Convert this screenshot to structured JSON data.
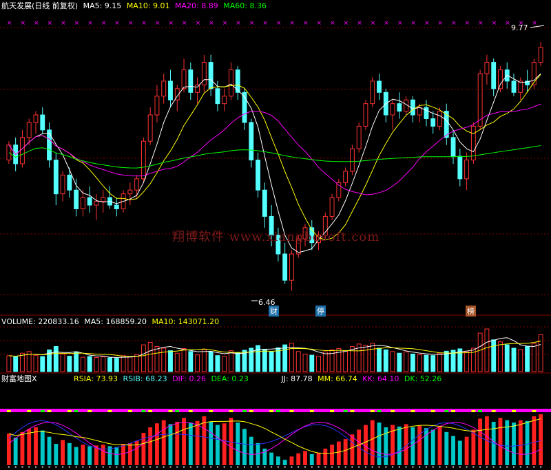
{
  "main_header": {
    "title": "航天发展(日线 前复权)",
    "ma5": "MA5: 9.15",
    "ma10": "MA10: 9.01",
    "ma20": "MA20: 8.89",
    "ma60": "MA60: 8.36"
  },
  "volume_header": {
    "title": "VOLUME: 220833.16",
    "ma5": "MA5: 168859.20",
    "ma10": "MA10: 143071.20"
  },
  "indicator_header": {
    "title": "财富地图X",
    "rsia": "RSIA: 73.93",
    "rsib": "RSIB: 68.23",
    "dif": "DIF: 0.26",
    "dea": "DEA: 0.23",
    "jj": "JJ: 87.78",
    "mm": "MM: 66.74",
    "kk": "KK: 64.10",
    "dk": "DK: 52.26"
  },
  "annotations": {
    "high_label": "9.77",
    "low_label": "6.46",
    "signal_1": "财",
    "signal_2": "停",
    "signal_3": "榜"
  },
  "watermark": "翔博软件 www.xiangbosoft.com",
  "colors": {
    "up": "#ff3232",
    "down": "#54ffff",
    "ma5": "#ffffff",
    "ma10": "#ffff00",
    "ma20": "#ff00ff",
    "ma60": "#00ff00",
    "grid": "#8b0000"
  },
  "chart_data": {
    "type": "candlestick",
    "price_ylim": [
      6.3,
      10.0
    ],
    "candles": [
      [
        8.2,
        8.45,
        8.15,
        8.4
      ],
      [
        8.4,
        8.5,
        8.05,
        8.15
      ],
      [
        8.15,
        8.6,
        8.1,
        8.5
      ],
      [
        8.5,
        8.75,
        8.4,
        8.7
      ],
      [
        8.7,
        8.85,
        8.55,
        8.8
      ],
      [
        8.8,
        8.9,
        8.55,
        8.6
      ],
      [
        8.6,
        8.7,
        8.1,
        8.2
      ],
      [
        8.2,
        8.3,
        7.6,
        7.75
      ],
      [
        7.75,
        8.05,
        7.65,
        8.0
      ],
      [
        8.0,
        8.1,
        7.7,
        7.8
      ],
      [
        7.8,
        7.95,
        7.45,
        7.55
      ],
      [
        7.55,
        7.8,
        7.45,
        7.7
      ],
      [
        7.7,
        7.85,
        7.5,
        7.6
      ],
      [
        7.6,
        7.75,
        7.4,
        7.65
      ],
      [
        7.65,
        7.8,
        7.5,
        7.7
      ],
      [
        7.7,
        7.85,
        7.55,
        7.6
      ],
      [
        7.6,
        7.7,
        7.45,
        7.55
      ],
      [
        7.55,
        7.8,
        7.5,
        7.75
      ],
      [
        7.75,
        7.9,
        7.6,
        7.8
      ],
      [
        7.8,
        8.0,
        7.7,
        7.95
      ],
      [
        7.95,
        8.5,
        7.9,
        8.45
      ],
      [
        8.45,
        8.9,
        8.4,
        8.8
      ],
      [
        8.8,
        9.2,
        8.7,
        9.05
      ],
      [
        9.05,
        9.35,
        8.95,
        9.25
      ],
      [
        9.25,
        9.4,
        8.9,
        9.0
      ],
      [
        9.0,
        9.2,
        8.85,
        9.15
      ],
      [
        9.15,
        9.55,
        9.1,
        9.4
      ],
      [
        9.4,
        9.5,
        9.0,
        9.1
      ],
      [
        9.1,
        9.3,
        8.95,
        9.2
      ],
      [
        9.2,
        9.6,
        9.1,
        9.5
      ],
      [
        9.5,
        9.6,
        9.05,
        9.15
      ],
      [
        9.15,
        9.25,
        8.85,
        8.95
      ],
      [
        8.95,
        9.15,
        8.85,
        9.05
      ],
      [
        9.05,
        9.5,
        9.0,
        9.4
      ],
      [
        9.4,
        9.45,
        9.0,
        9.1
      ],
      [
        9.1,
        9.15,
        8.6,
        8.7
      ],
      [
        8.7,
        8.75,
        8.1,
        8.2
      ],
      [
        8.2,
        8.3,
        7.7,
        7.8
      ],
      [
        7.8,
        7.9,
        7.3,
        7.45
      ],
      [
        7.45,
        7.6,
        7.05,
        7.2
      ],
      [
        7.2,
        7.3,
        6.85,
        6.95
      ],
      [
        6.95,
        7.1,
        6.55,
        6.6
      ],
      [
        6.6,
        7.0,
        6.46,
        6.95
      ],
      [
        6.95,
        7.2,
        6.9,
        7.15
      ],
      [
        7.15,
        7.35,
        7.05,
        7.3
      ],
      [
        7.3,
        7.4,
        7.0,
        7.1
      ],
      [
        7.1,
        7.25,
        7.0,
        7.2
      ],
      [
        7.2,
        7.5,
        7.15,
        7.45
      ],
      [
        7.45,
        7.75,
        7.4,
        7.7
      ],
      [
        7.7,
        7.95,
        7.65,
        7.9
      ],
      [
        7.9,
        8.1,
        7.85,
        8.05
      ],
      [
        8.05,
        8.4,
        8.0,
        8.35
      ],
      [
        8.35,
        8.7,
        8.3,
        8.65
      ],
      [
        8.65,
        9.0,
        8.6,
        8.95
      ],
      [
        8.95,
        9.3,
        8.9,
        9.25
      ],
      [
        9.25,
        9.35,
        9.0,
        9.1
      ],
      [
        9.1,
        9.15,
        8.7,
        8.8
      ],
      [
        8.8,
        9.0,
        8.6,
        8.95
      ],
      [
        8.95,
        9.1,
        8.75,
        8.85
      ],
      [
        8.85,
        9.05,
        8.8,
        9.0
      ],
      [
        9.0,
        9.05,
        8.7,
        8.8
      ],
      [
        8.8,
        8.95,
        8.7,
        8.9
      ],
      [
        8.9,
        9.0,
        8.65,
        8.75
      ],
      [
        8.75,
        8.85,
        8.55,
        8.65
      ],
      [
        8.65,
        8.9,
        8.6,
        8.85
      ],
      [
        8.85,
        8.95,
        8.4,
        8.5
      ],
      [
        8.5,
        8.6,
        8.15,
        8.25
      ],
      [
        8.25,
        8.35,
        7.85,
        7.95
      ],
      [
        7.95,
        8.3,
        7.8,
        8.2
      ],
      [
        8.2,
        8.7,
        8.15,
        8.65
      ],
      [
        8.65,
        9.4,
        8.6,
        9.35
      ],
      [
        9.35,
        9.6,
        9.2,
        9.5
      ],
      [
        9.5,
        9.55,
        9.05,
        9.15
      ],
      [
        9.15,
        9.45,
        9.1,
        9.4
      ],
      [
        9.4,
        9.5,
        9.15,
        9.25
      ],
      [
        9.25,
        9.35,
        9.05,
        9.1
      ],
      [
        9.1,
        9.3,
        9.0,
        9.25
      ],
      [
        9.25,
        9.4,
        9.1,
        9.2
      ],
      [
        9.2,
        9.55,
        9.15,
        9.5
      ],
      [
        9.5,
        9.77,
        9.45,
        9.7
      ]
    ],
    "volume": [
      95000,
      88000,
      110000,
      120000,
      98000,
      90000,
      130000,
      150000,
      105000,
      92000,
      118000,
      86000,
      90000,
      84000,
      88000,
      82000,
      80000,
      95000,
      90000,
      102000,
      160000,
      175000,
      150000,
      140000,
      125000,
      110000,
      138000,
      120000,
      100000,
      132000,
      118000,
      96000,
      90000,
      125000,
      112000,
      128000,
      140000,
      156000,
      132000,
      118000,
      142000,
      160000,
      170000,
      120000,
      105000,
      98000,
      92000,
      118000,
      130000,
      138000,
      125000,
      150000,
      165000,
      158000,
      170000,
      140000,
      130000,
      120000,
      110000,
      118000,
      105000,
      100000,
      98000,
      96000,
      110000,
      122000,
      128000,
      136000,
      118000,
      140000,
      230000,
      255000,
      190000,
      178000,
      160000,
      140000,
      132000,
      150000,
      168859,
      220833
    ],
    "indicator_ylim": [
      0,
      100
    ]
  }
}
